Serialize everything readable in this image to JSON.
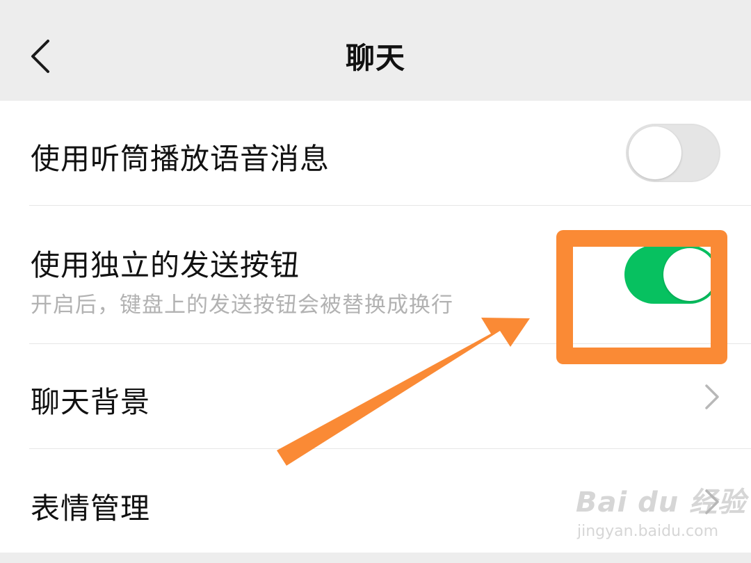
{
  "header": {
    "title": "聊天"
  },
  "settings": [
    {
      "label": "使用听筒播放语音消息",
      "type": "toggle",
      "state": "off"
    },
    {
      "label": "使用独立的发送按钮",
      "subtitle": "开启后，键盘上的发送按钮会被替换成换行",
      "type": "toggle",
      "state": "on"
    },
    {
      "label": "聊天背景",
      "type": "link"
    },
    {
      "label": "表情管理",
      "type": "link"
    }
  ],
  "colors": {
    "toggle_on": "#07c160",
    "annotation": "#fa8a35",
    "header_bg": "#ededed"
  },
  "icons": {
    "back": "chevron-left-icon",
    "row_arrow": "chevron-right-icon"
  },
  "watermark": {
    "brand": "Bai du 经验",
    "url": "jingyan.baidu.com"
  }
}
